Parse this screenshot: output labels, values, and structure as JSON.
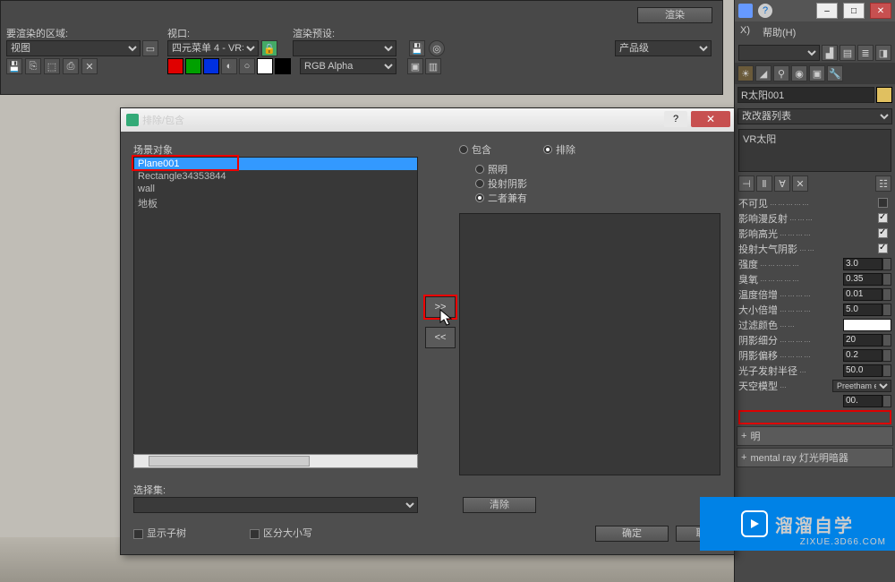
{
  "toolbar": {
    "area_label": "要渲染的区域:",
    "area_value": "视图",
    "viewport_label": "视口:",
    "viewport_value": "四元菜单 4 - VR‡",
    "preset_label": "渲染预设:",
    "preset_value": "",
    "quality_value": "产品级",
    "render_btn": "渲染",
    "channel": "RGB Alpha"
  },
  "dialog": {
    "title": "排除/包含",
    "scene_label": "场景对象",
    "items": [
      "Plane001",
      "Rectangle34353844",
      "wall",
      "地板"
    ],
    "include": "包含",
    "exclude": "排除",
    "opt_light": "照明",
    "opt_shadow": "投射阴影",
    "opt_both": "二者兼有",
    "move_r": ">>",
    "move_l": "<<",
    "selset_label": "选择集:",
    "clear": "清除",
    "show_tree": "显示子树",
    "case": "区分大小写",
    "ok": "确定",
    "cancel": "取"
  },
  "menu": {
    "x": "X)",
    "help": "帮助(H)"
  },
  "side": {
    "object_name": "R太阳001",
    "modlist": "改改器列表",
    "mod1": "VR太阳",
    "params": [
      {
        "label": "不可见",
        "chk": false
      },
      {
        "label": "影响漫反射",
        "chk": true
      },
      {
        "label": "影响高光",
        "chk": true
      },
      {
        "label": "投射大气阴影",
        "chk": true
      }
    ],
    "values": [
      {
        "label": "强度",
        "v": "3.0"
      },
      {
        "label": "臭氧",
        "v": "0.35"
      },
      {
        "label": "温度倍增",
        "v": "0.01"
      },
      {
        "label": "大小倍增",
        "v": "5.0"
      }
    ],
    "color_label": "过滤颜色",
    "values2": [
      {
        "label": "阴影细分",
        "v": "20"
      },
      {
        "label": "阴影偏移",
        "v": "0.2"
      },
      {
        "label": "光子发射半径",
        "v": "50.0"
      }
    ],
    "sky_label": "天空模型",
    "sky_value": "Preetham et",
    "val_00": "00.",
    "rollout2": "明",
    "rollout3": "mental ray 灯光明暗器"
  },
  "logo": {
    "txt": "溜溜自学",
    "url": "ZIXUE.3D66.COM"
  }
}
